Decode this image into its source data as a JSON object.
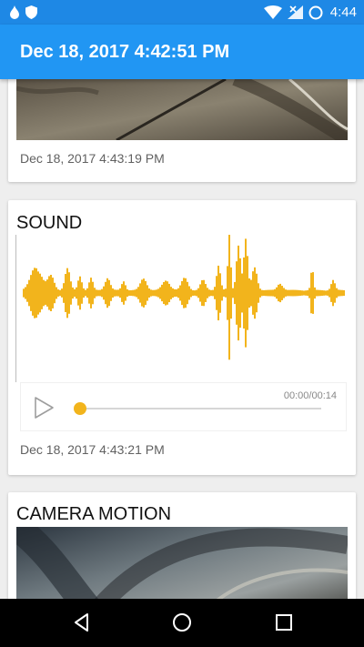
{
  "status_bar": {
    "time": "4:44",
    "background": "#1e88e5",
    "icons": [
      "notification-drop-icon",
      "shield-icon",
      "wifi-icon",
      "signal-off-icon",
      "battery-charging-icon"
    ]
  },
  "app_bar": {
    "title": "Dec 18, 2017 4:42:51 PM",
    "background": "#2196f3"
  },
  "cards": [
    {
      "type": "image",
      "timestamp": "Dec 18, 2017 4:43:19 PM"
    },
    {
      "type": "sound",
      "title": "SOUND",
      "player": {
        "time_display": "00:00/00:14",
        "progress": 0
      },
      "waveform_color": "#f2b41c",
      "timestamp": "Dec 18, 2017 4:43:21 PM"
    },
    {
      "type": "image",
      "title": "CAMERA MOTION"
    }
  ],
  "nav_bar": {
    "buttons": [
      "back-icon",
      "home-icon",
      "recents-icon"
    ]
  }
}
